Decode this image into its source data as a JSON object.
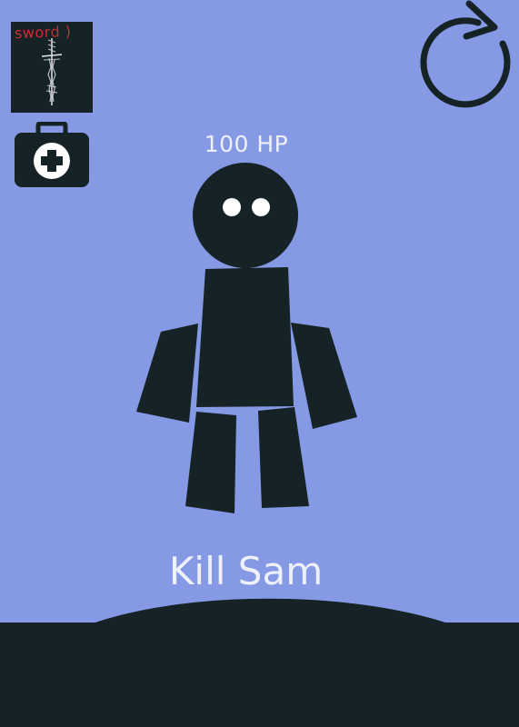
{
  "hud": {
    "inventory": {
      "sword_label": "sword )"
    },
    "player_hp": "100 HP"
  },
  "title": "Kill Sam",
  "icons": {
    "sword": "sword-icon",
    "medkit": "medkit-icon",
    "restart": "restart-icon"
  },
  "colors": {
    "background": "#8599e4",
    "silhouette": "#152226",
    "text": "#eef1fb",
    "eyes": "#ffffff",
    "sword_label": "#cf2b34"
  }
}
